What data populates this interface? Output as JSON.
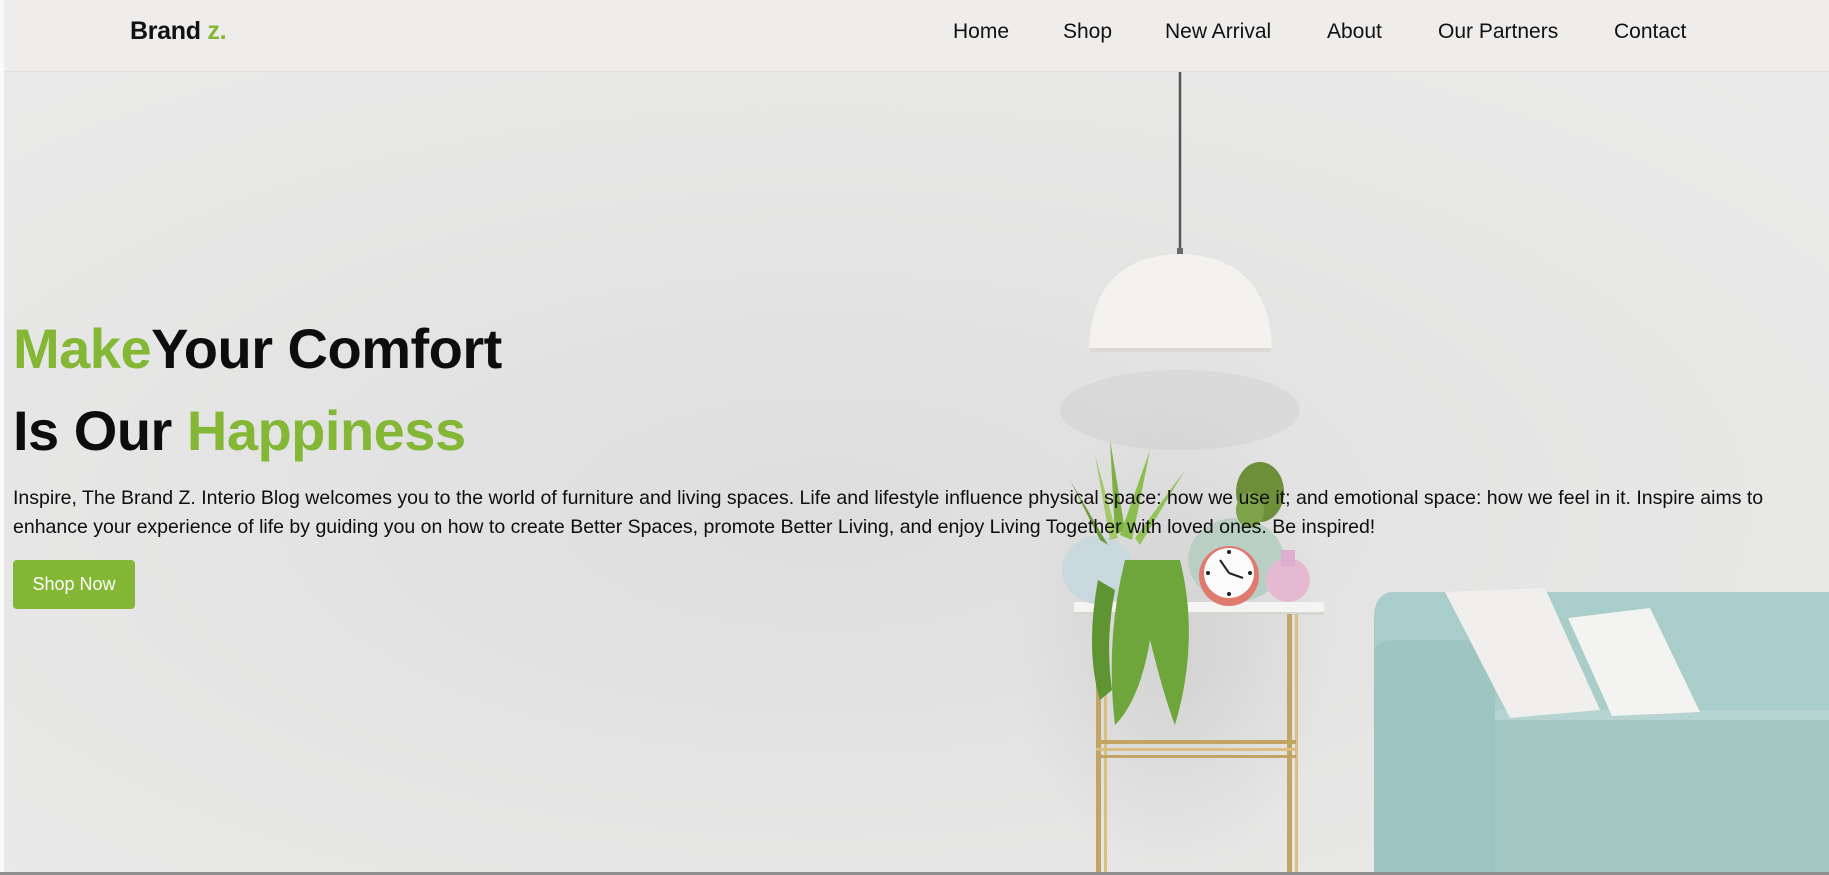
{
  "header": {
    "brand": {
      "name": "Brand",
      "suffix": "z."
    },
    "nav": [
      {
        "label": "Home"
      },
      {
        "label": "Shop"
      },
      {
        "label": "New Arrival"
      },
      {
        "label": "About"
      },
      {
        "label": "Our Partners"
      },
      {
        "label": "Contact"
      }
    ]
  },
  "hero": {
    "line1": {
      "accent": "Make",
      "rest": "Your Comfort"
    },
    "line2": {
      "lead": "Is Our",
      "accent": "Happiness"
    },
    "description": "Inspire, The Brand Z. Interio Blog welcomes you to the world of furniture and living spaces. Life and lifestyle influence physical space: how we use it; and emotional space: how we feel in it. Inspire aims to enhance your experience of life by guiding you on how to create Better Spaces, promote Better Living, and enjoy Living Together with loved ones. Be inspired!",
    "cta_label": "Shop Now"
  },
  "colors": {
    "accent": "#83b735",
    "text": "#111111",
    "background": "#e6e6e5",
    "sofa": "#a9cdca"
  },
  "icons": [
    "pendant-lamp-icon",
    "plants-icon",
    "clock-icon",
    "side-table-icon",
    "sofa-icon"
  ]
}
